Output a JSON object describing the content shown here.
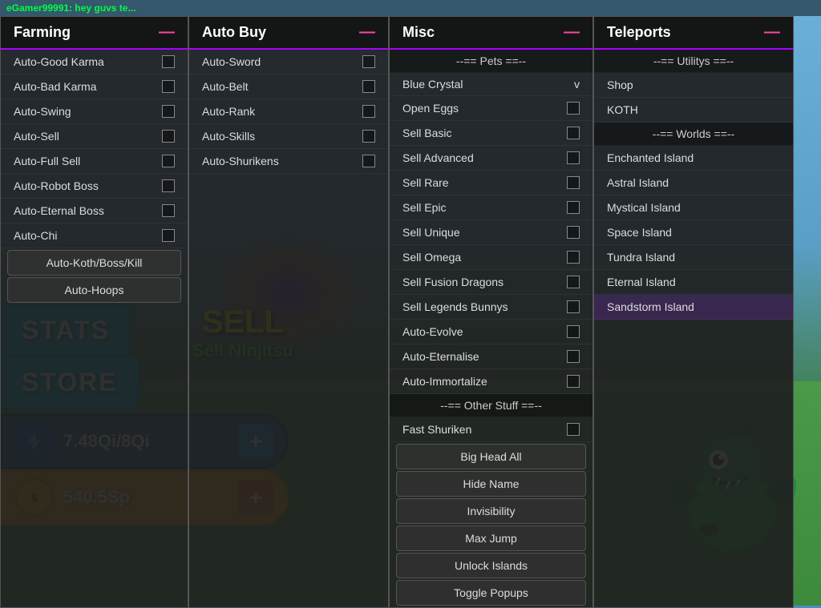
{
  "topBar": {
    "username": "eGamer99991: hey guvs te..."
  },
  "game": {
    "sell_text": "SELL",
    "sell_sub": "Sell Ninjitsu",
    "energy_value": "7.48Qi/8Qi",
    "coins_value": "540.5Sp",
    "stats_label": "STATS",
    "store_label": "STORE",
    "plus_label": "+"
  },
  "farming": {
    "header": "Farming",
    "close": "—",
    "items": [
      {
        "label": "Auto-Good Karma",
        "has_checkbox": true
      },
      {
        "label": "Auto-Bad Karma",
        "has_checkbox": true
      },
      {
        "label": "Auto-Swing",
        "has_checkbox": true
      },
      {
        "label": "Auto-Sell",
        "has_checkbox": true
      },
      {
        "label": "Auto-Full Sell",
        "has_checkbox": true
      },
      {
        "label": "Auto-Robot Boss",
        "has_checkbox": true
      },
      {
        "label": "Auto-Eternal Boss",
        "has_checkbox": true
      },
      {
        "label": "Auto-Chi",
        "has_checkbox": true
      },
      {
        "label": "Auto-Koth/Boss/Kill",
        "has_checkbox": false,
        "btn": true
      },
      {
        "label": "Auto-Hoops",
        "has_checkbox": false,
        "btn": true
      }
    ]
  },
  "autoBuy": {
    "header": "Auto Buy",
    "close": "—",
    "items": [
      {
        "label": "Auto-Sword",
        "has_checkbox": true
      },
      {
        "label": "Auto-Belt",
        "has_checkbox": true
      },
      {
        "label": "Auto-Rank",
        "has_checkbox": true
      },
      {
        "label": "Auto-Skills",
        "has_checkbox": true
      },
      {
        "label": "Auto-Shurikens",
        "has_checkbox": true
      }
    ]
  },
  "misc": {
    "header": "Misc",
    "close": "—",
    "sections": {
      "pets_header": "--== Pets ==--",
      "other_header": "--== Other Stuff ==--"
    },
    "pet_selected": "Blue Crystal",
    "pet_arrow": "v",
    "items_top": [
      {
        "label": "Open Eggs",
        "has_checkbox": true
      },
      {
        "label": "Sell Basic",
        "has_checkbox": true
      },
      {
        "label": "Sell Advanced",
        "has_checkbox": true
      },
      {
        "label": "Sell Rare",
        "has_checkbox": true
      },
      {
        "label": "Sell Epic",
        "has_checkbox": true
      },
      {
        "label": "Sell Unique",
        "has_checkbox": true
      },
      {
        "label": "Sell Omega",
        "has_checkbox": true
      },
      {
        "label": "Sell Fusion Dragons",
        "has_checkbox": true
      },
      {
        "label": "Sell Legends Bunnys",
        "has_checkbox": true
      },
      {
        "label": "Auto-Evolve",
        "has_checkbox": true
      },
      {
        "label": "Auto-Eternalise",
        "has_checkbox": true
      },
      {
        "label": "Auto-Immortalize",
        "has_checkbox": true
      }
    ],
    "items_other": [
      {
        "label": "Fast Shuriken",
        "has_checkbox": true
      },
      {
        "label": "Big Head All",
        "has_checkbox": false,
        "btn": true
      },
      {
        "label": "Hide Name",
        "has_checkbox": false,
        "btn": true
      },
      {
        "label": "Invisibility",
        "has_checkbox": false,
        "btn": true
      },
      {
        "label": "Max Jump",
        "has_checkbox": false,
        "btn": true
      },
      {
        "label": "Unlock Islands",
        "has_checkbox": false,
        "btn": true
      },
      {
        "label": "Toggle Popups",
        "has_checkbox": false,
        "btn": true
      }
    ]
  },
  "teleports": {
    "header": "Teleports",
    "close": "—",
    "sections": {
      "utilities_header": "--== Utilitys ==--",
      "worlds_header": "--== Worlds ==--"
    },
    "utilities": [
      {
        "label": "Shop"
      },
      {
        "label": "KOTH"
      }
    ],
    "worlds": [
      {
        "label": "Enchanted Island"
      },
      {
        "label": "Astral Island"
      },
      {
        "label": "Mystical Island"
      },
      {
        "label": "Space Island"
      },
      {
        "label": "Tundra Island"
      },
      {
        "label": "Eternal Island"
      },
      {
        "label": "Sandstorm Island",
        "selected": true
      }
    ]
  }
}
